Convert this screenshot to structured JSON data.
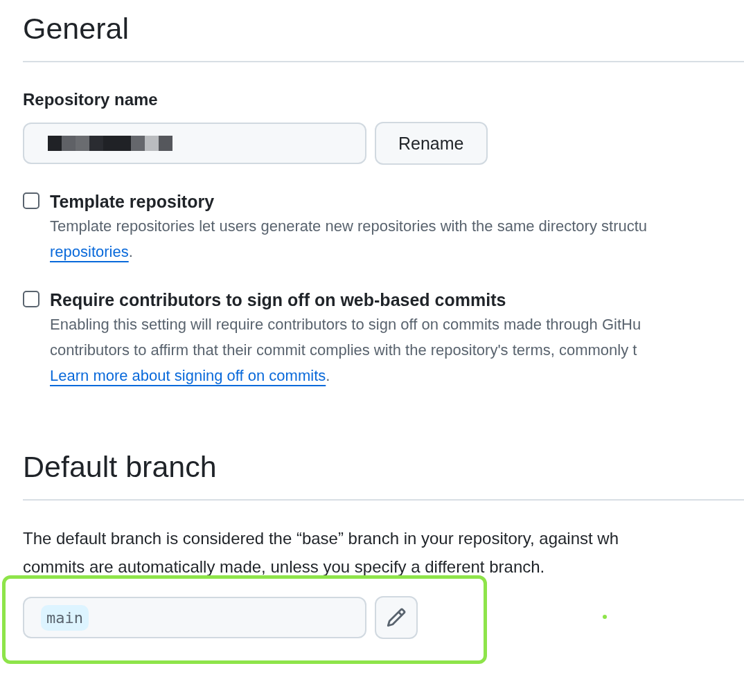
{
  "general": {
    "title": "General",
    "repository_name": {
      "label": "Repository name",
      "button": "Rename"
    },
    "options": [
      {
        "label": "Template repository",
        "checked": false,
        "lines": [
          "Template repositories let users generate new repositories with the same directory structu"
        ],
        "link": "repositories",
        "link_suffix": "."
      },
      {
        "label": "Require contributors to sign off on web-based commits",
        "checked": false,
        "lines": [
          "Enabling this setting will require contributors to sign off on commits made through GitHu",
          "contributors to affirm that their commit complies with the repository's terms, commonly t"
        ],
        "link": "Learn more about signing off on commits",
        "link_suffix": "."
      }
    ]
  },
  "default_branch": {
    "title": "Default branch",
    "description": [
      "The default branch is considered the “base” branch in your repository, against wh",
      "commits are automatically made, unless you specify a different branch."
    ],
    "branch": "main"
  }
}
